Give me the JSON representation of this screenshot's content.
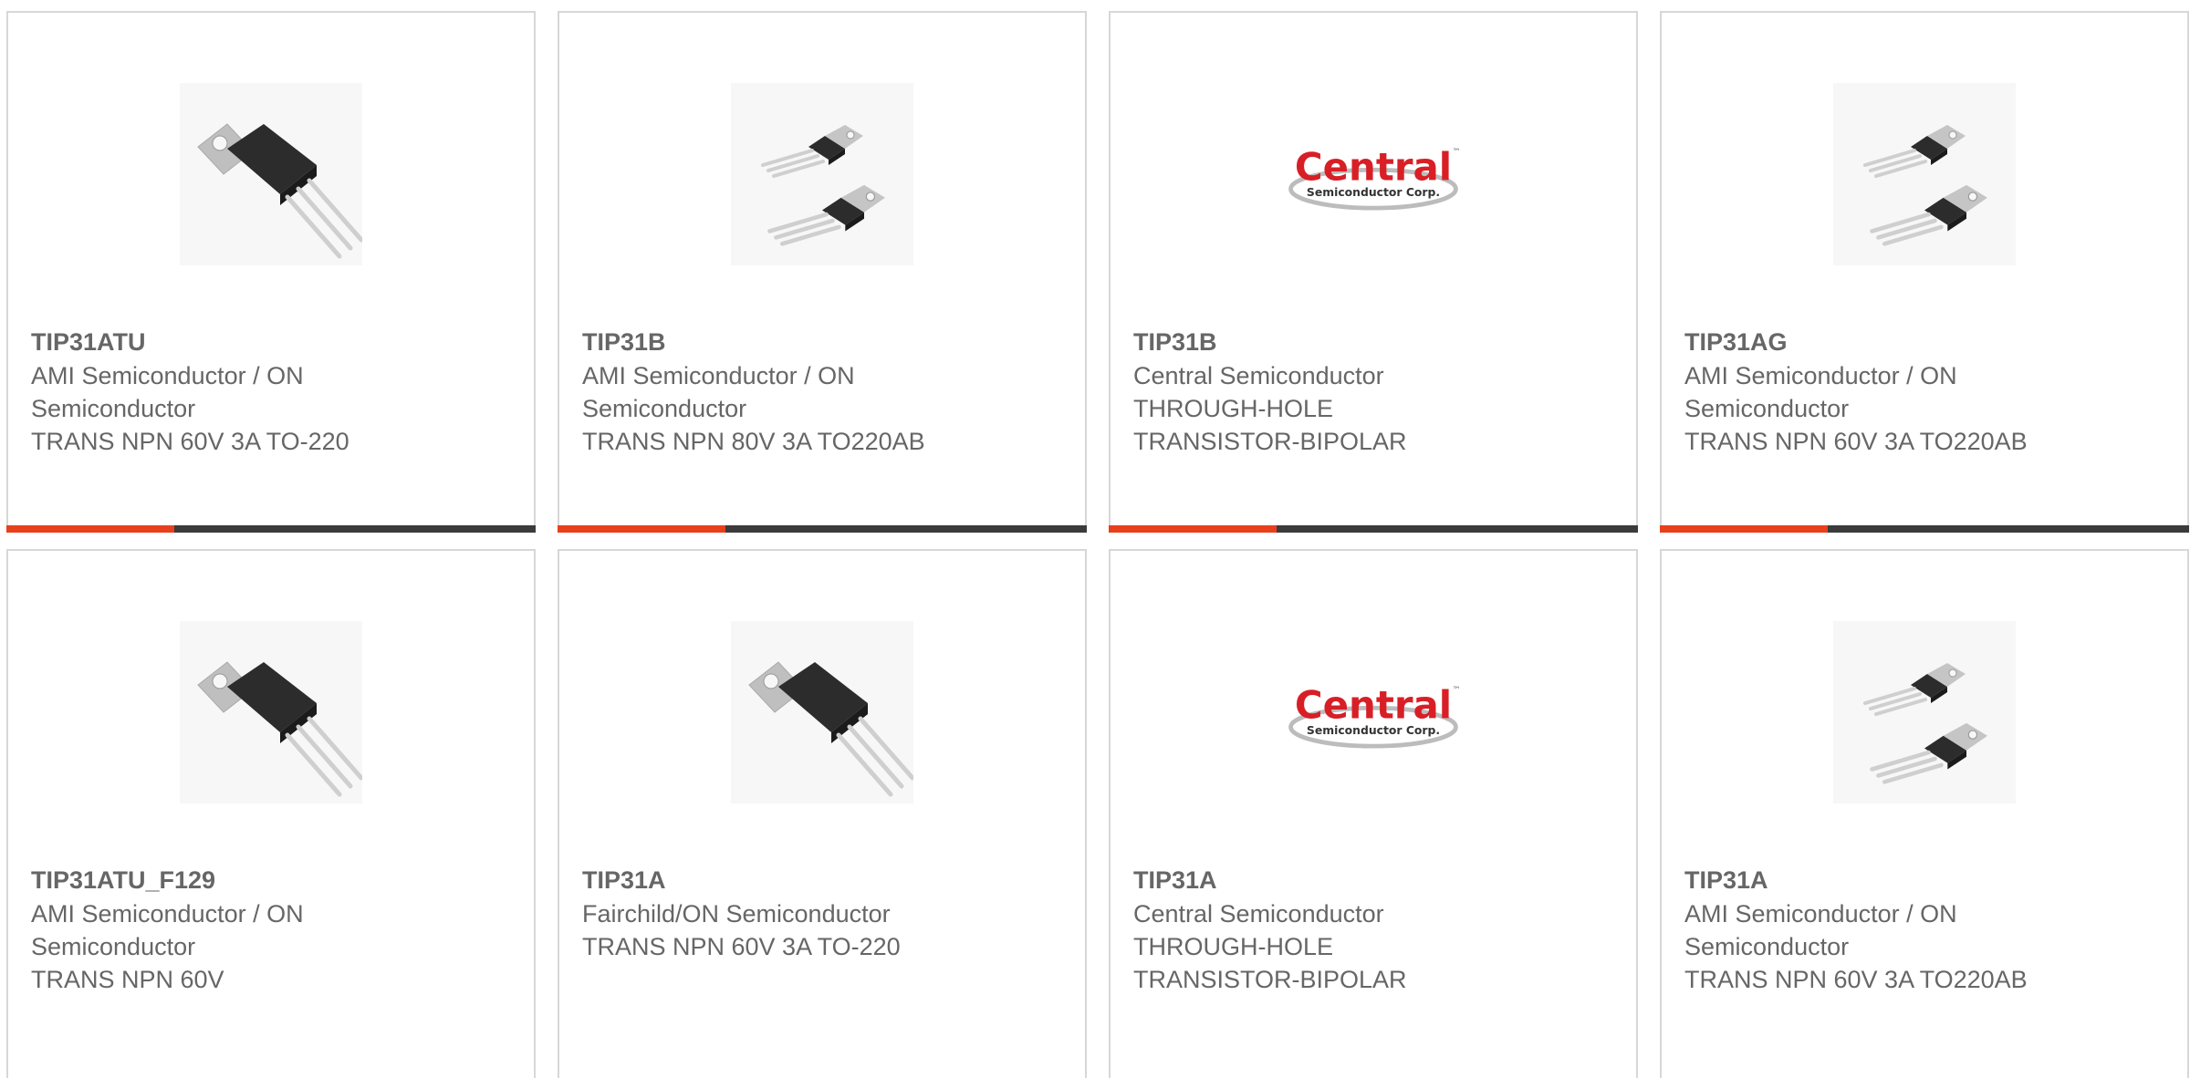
{
  "colors": {
    "accent": "#e8401c",
    "bar": "#3b3b3b",
    "text": "#666666",
    "border": "#d7d7d7",
    "central_red": "#d81f26"
  },
  "products": [
    {
      "part": "TIP31ATU",
      "lines": [
        "AMI Semiconductor / ON",
        "Semiconductor",
        "TRANS NPN 60V 3A TO-220"
      ],
      "image": "single-transistor-image"
    },
    {
      "part": "TIP31B",
      "lines": [
        "AMI Semiconductor / ON",
        "Semiconductor",
        "TRANS NPN 80V 3A TO220AB"
      ],
      "image": "dual-transistor-image"
    },
    {
      "part": "TIP31B",
      "lines": [
        "Central Semiconductor",
        "THROUGH-HOLE",
        "TRANSISTOR-BIPOLAR"
      ],
      "image": "central-logo"
    },
    {
      "part": "TIP31AG",
      "lines": [
        "AMI Semiconductor / ON",
        "Semiconductor",
        "TRANS NPN 60V 3A TO220AB"
      ],
      "image": "dual-transistor-image"
    },
    {
      "part": "TIP31ATU_F129",
      "lines": [
        "AMI Semiconductor / ON",
        "Semiconductor",
        "TRANS NPN 60V"
      ],
      "image": "single-transistor-image"
    },
    {
      "part": "TIP31A",
      "lines": [
        "Fairchild/ON Semiconductor",
        "TRANS NPN 60V 3A TO-220"
      ],
      "image": "single-transistor-image"
    },
    {
      "part": "TIP31A",
      "lines": [
        "Central Semiconductor",
        "THROUGH-HOLE",
        "TRANSISTOR-BIPOLAR"
      ],
      "image": "central-logo"
    },
    {
      "part": "TIP31A",
      "lines": [
        "AMI Semiconductor / ON",
        "Semiconductor",
        "TRANS NPN 60V 3A TO220AB"
      ],
      "image": "dual-transistor-image"
    }
  ],
  "logo": {
    "name": "Central",
    "sub": "Semiconductor Corp.",
    "tm": "™"
  }
}
